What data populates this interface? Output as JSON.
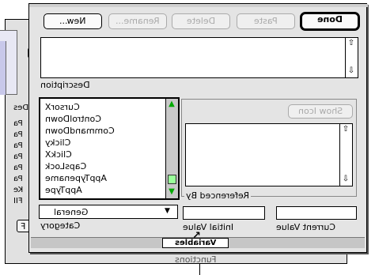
{
  "background_window": {
    "title": "Functions",
    "label_des": "Des",
    "rows": [
      "Pa",
      "Pa",
      "Pa",
      "Pa",
      "Pa",
      "Pa",
      "Ke",
      "FII"
    ],
    "small_button": "F"
  },
  "toolbar": {
    "new_label": "New...",
    "rename_label": "Rename...",
    "delete_label": "Delete",
    "paste_label": "Paste",
    "done_label": "Done"
  },
  "description": {
    "label": "Description",
    "value": ""
  },
  "variables_list": {
    "items": [
      "CursorX",
      "ControlDown",
      "CommandDown",
      "Clicky",
      "ClickX",
      "CapsLock",
      "AppTypename",
      "AppType"
    ],
    "selected_index": -1
  },
  "show_icon_label": "Show Icon",
  "referenced_by": {
    "label": "Referenced By",
    "items": []
  },
  "category": {
    "label": "Category",
    "selected": "General"
  },
  "initial_value": {
    "label": "Initial Value",
    "value": ""
  },
  "current_value": {
    "label": "Current Value",
    "value": ""
  },
  "tab_label": "Variables",
  "icons": {
    "scroll_up": "up-arrow-icon",
    "scroll_down": "down-arrow-icon",
    "dropdown": "triangle-down-icon",
    "cursor": "arrow-cursor-icon"
  }
}
